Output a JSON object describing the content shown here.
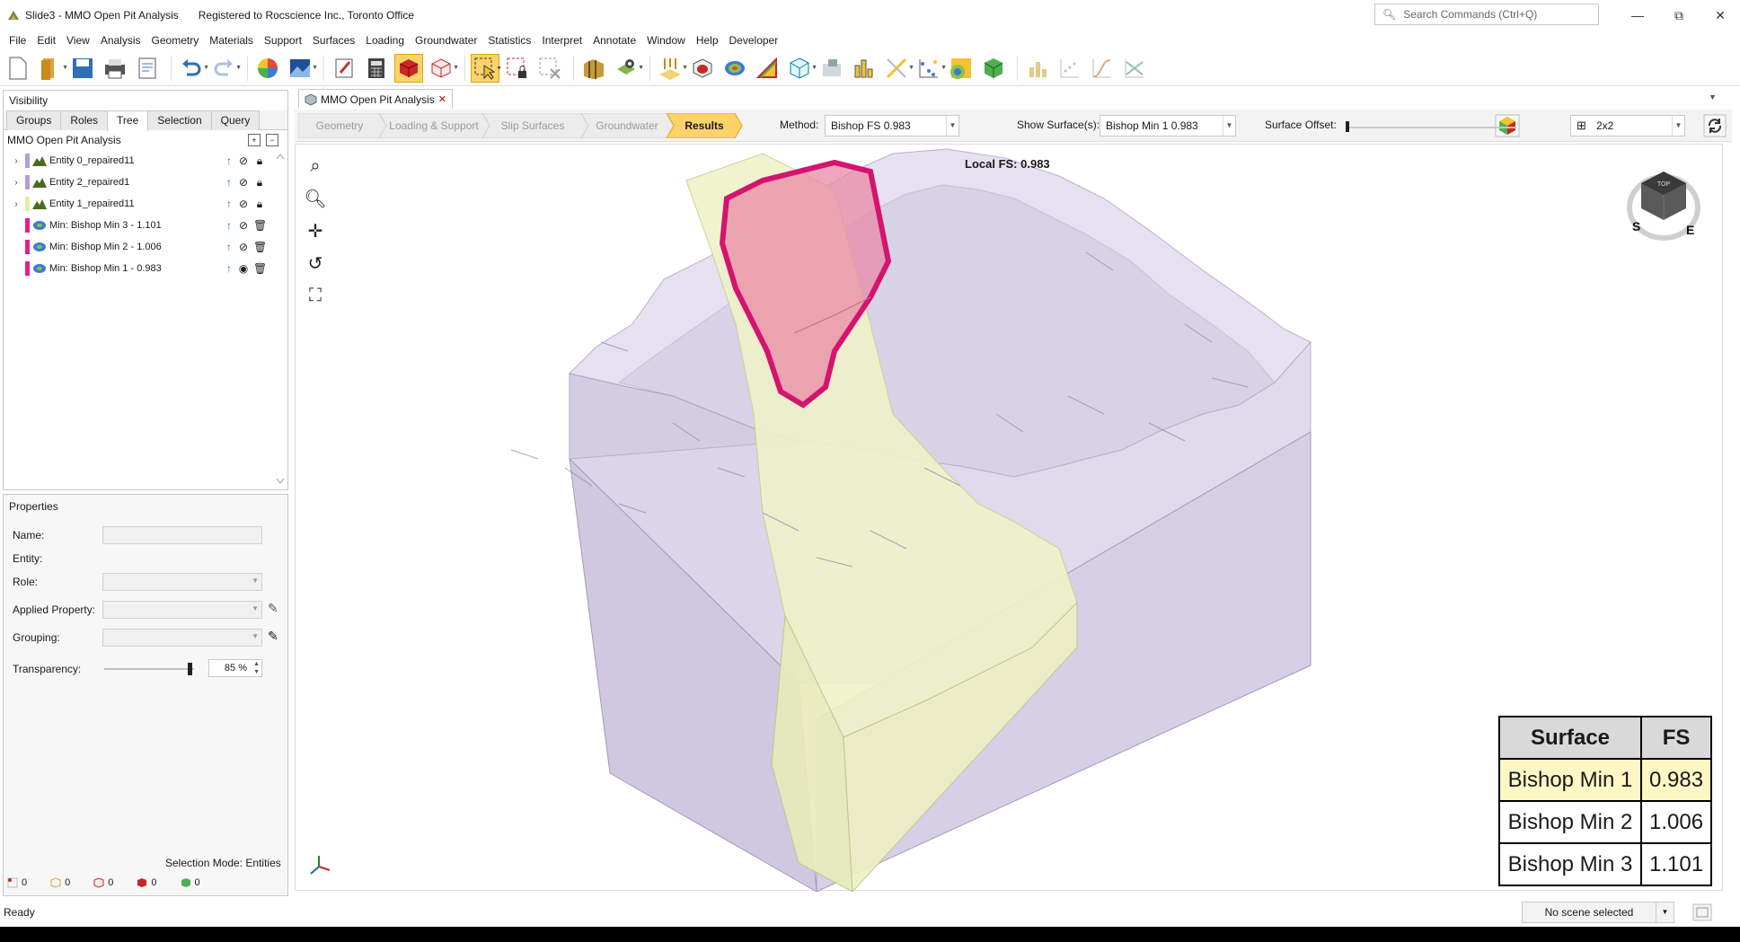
{
  "titlebar": {
    "title": "Slide3 - MMO Open Pit Analysis",
    "registered": "Registered to Rocscience Inc., Toronto Office",
    "search_placeholder": "Search Commands (Ctrl+Q)"
  },
  "menu": [
    "File",
    "Edit",
    "View",
    "Analysis",
    "Geometry",
    "Materials",
    "Support",
    "Surfaces",
    "Loading",
    "Groundwater",
    "Statistics",
    "Interpret",
    "Annotate",
    "Window",
    "Help",
    "Developer"
  ],
  "visibility": {
    "title": "Visibility",
    "tabs": [
      "Groups",
      "Roles",
      "Tree",
      "Selection",
      "Query"
    ],
    "selected_tab": "Tree",
    "tree_root": "MMO Open Pit Analysis",
    "items": [
      {
        "label": "Entity 0_repaired11",
        "swatch": "#b39ddb",
        "type": "entity"
      },
      {
        "label": "Entity 2_repaired1",
        "swatch": "#b39ddb",
        "type": "entity"
      },
      {
        "label": "Entity 1_repaired11",
        "swatch": "#e6ee9c",
        "type": "entity"
      },
      {
        "label": "Min: Bishop Min 3  -  1.101",
        "swatch": "#e91e8c",
        "type": "surface"
      },
      {
        "label": "Min: Bishop Min 2  -  1.006",
        "swatch": "#e91e8c",
        "type": "surface"
      },
      {
        "label": "Min: Bishop Min 1  -  0.983",
        "swatch": "#e91e8c",
        "type": "surface"
      }
    ]
  },
  "properties": {
    "title": "Properties",
    "name_label": "Name:",
    "entity_label": "Entity:",
    "role_label": "Role:",
    "applied_label": "Applied Property:",
    "grouping_label": "Grouping:",
    "transparency_label": "Transparency:",
    "transparency_value": "85 %",
    "selection_mode": "Selection Mode:  Entities",
    "counts": [
      "0",
      "0",
      "0",
      "0",
      "0"
    ]
  },
  "document": {
    "tab": "MMO Open Pit Analysis"
  },
  "workflow": {
    "steps": [
      "Geometry",
      "Loading & Support",
      "Slip Surfaces",
      "Groundwater",
      "Results"
    ],
    "current": "Results",
    "method_label": "Method:",
    "method_value": "Bishop FS     0.983",
    "show_label": "Show Surface(s):",
    "show_value": "Bishop Min 1  0.983",
    "offset_label": "Surface Offset:",
    "layout_value": "2x2"
  },
  "viewport": {
    "local_fs": "Local FS: 0.983",
    "compass": {
      "top": "TOP",
      "s": "S",
      "e": "E"
    }
  },
  "fs_table": {
    "headers": [
      "Surface",
      "FS"
    ],
    "rows": [
      {
        "surface": "Bishop Min 1",
        "fs": "0.983"
      },
      {
        "surface": "Bishop Min 2",
        "fs": "1.006"
      },
      {
        "surface": "Bishop Min 3",
        "fs": "1.101"
      }
    ],
    "highlight_color": "#fdf7c5"
  },
  "status": {
    "ready": "Ready",
    "scene": "No scene selected"
  },
  "colors": {
    "accent": "#fcd26a",
    "slip_surface": "#e91e8c",
    "block": "#d9d3e8",
    "fault": "#eef0c4"
  }
}
